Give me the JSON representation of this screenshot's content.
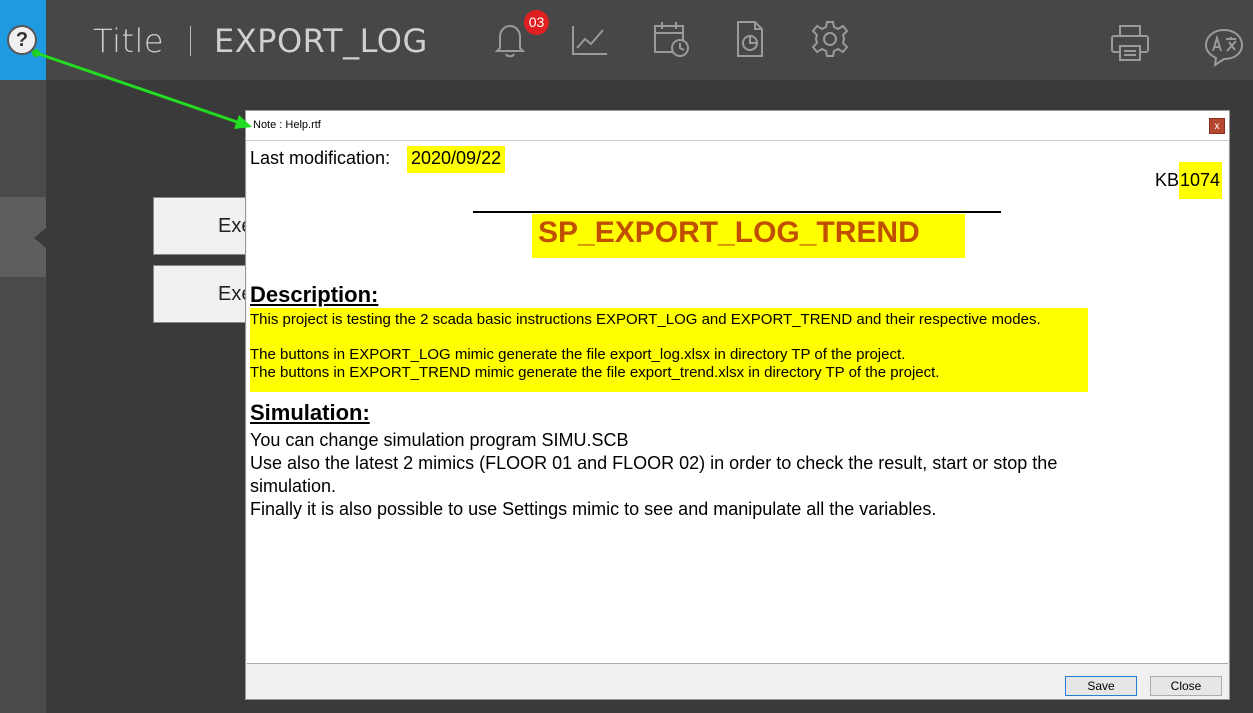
{
  "topbar": {
    "help_symbol": "?",
    "title": "Title",
    "mimic_name": "EXPORT_LOG",
    "alarm_count": "03",
    "icons": [
      "bell-icon",
      "trend-icon",
      "calendar-clock-icon",
      "report-icon",
      "gear-icon",
      "printer-icon",
      "translate-icon"
    ],
    "accent_color": "#1e9ae0"
  },
  "background_buttons": [
    "Exe",
    "Exe"
  ],
  "dialog": {
    "title": "Note : Help.rtf",
    "close_label": "x",
    "last_modification_label": "Last modification: ",
    "last_modification_date": "2020/09/22",
    "kb_prefix": "KB",
    "kb_number": "1074",
    "doc_title": "SP_EXPORT_LOG_TREND",
    "description_heading": "Description:",
    "description_lines": [
      "This project is testing the 2 scada basic instructions EXPORT_LOG and EXPORT_TREND and their respective modes.",
      "The buttons in EXPORT_LOG mimic generate the file export_log.xlsx in directory TP of the project.",
      "The buttons in EXPORT_TREND mimic generate the file export_trend.xlsx in directory TP of the project."
    ],
    "simulation_heading": "Simulation:",
    "simulation_lines": [
      "You can change simulation program SIMU.SCB",
      "Use also the latest 2 mimics (FLOOR 01 and FLOOR 02) in order to check the result, start or stop the",
      "simulation.",
      "Finally it is also possible to use Settings mimic to see and manipulate all the variables."
    ],
    "save_label": "Save",
    "close_button_label": "Close",
    "highlight_color": "#ffff00",
    "doc_title_color": "#c05000"
  }
}
